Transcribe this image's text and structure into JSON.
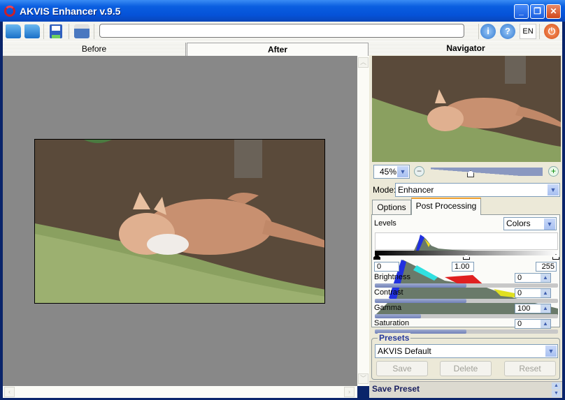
{
  "window": {
    "title": "AKVIS Enhancer v.9.5",
    "controls": [
      "minimize",
      "restore",
      "close"
    ]
  },
  "toolbar": {
    "buttons": [
      {
        "name": "open-icon"
      },
      {
        "name": "open-batch-icon"
      },
      {
        "name": "save-icon"
      },
      {
        "name": "print-icon"
      }
    ],
    "path_value": "",
    "info": "i",
    "help": "?",
    "language": "EN",
    "power": "⏻"
  },
  "view_tabs": [
    {
      "label": "Before",
      "active": false
    },
    {
      "label": "After",
      "active": true
    }
  ],
  "navigator": {
    "title": "Navigator",
    "zoom_value": "45%",
    "zoom_slider_fraction": 0.42
  },
  "mode": {
    "label": "Mode:",
    "value": "Enhancer"
  },
  "settings_tabs": [
    {
      "label": "Options",
      "active": false
    },
    {
      "label": "Post Processing",
      "active": true
    }
  ],
  "post_processing": {
    "levels_label": "Levels",
    "channel": "Colors",
    "levels_black": "0",
    "levels_mid": "1.00",
    "levels_white": "255",
    "params": [
      {
        "label": "Brightness",
        "value": "0",
        "fraction": 0.5
      },
      {
        "label": "Contrast",
        "value": "0",
        "fraction": 0.5
      },
      {
        "label": "Gamma",
        "value": "100",
        "fraction": 0.25
      },
      {
        "label": "Saturation",
        "value": "0",
        "fraction": 0.5
      }
    ]
  },
  "presets": {
    "title": "Presets",
    "selected": "AKVIS Default",
    "save": "Save",
    "delete": "Delete",
    "reset": "Reset"
  },
  "save_preset": {
    "label": "Save Preset"
  },
  "colors": {
    "accent": "#0552d8",
    "canvas": "#888888",
    "presets_title": "#24379a"
  }
}
